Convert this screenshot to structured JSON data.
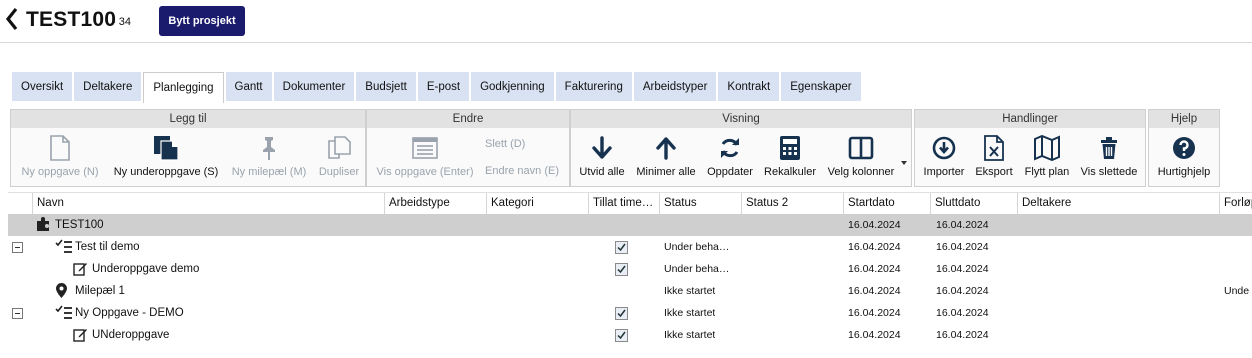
{
  "header": {
    "title": "TEST100",
    "subtitle": "- 34",
    "switch_project": "Bytt prosjekt"
  },
  "tabs": [
    {
      "label": "Oversikt"
    },
    {
      "label": "Deltakere"
    },
    {
      "label": "Planlegging",
      "active": true
    },
    {
      "label": "Gantt"
    },
    {
      "label": "Dokumenter"
    },
    {
      "label": "Budsjett"
    },
    {
      "label": "E-post"
    },
    {
      "label": "Godkjenning"
    },
    {
      "label": "Fakturering"
    },
    {
      "label": "Arbeidstyper"
    },
    {
      "label": "Kontrakt"
    },
    {
      "label": "Egenskaper"
    }
  ],
  "ribbon": {
    "legg_til": {
      "title": "Legg til",
      "ny_oppgave": "Ny oppgave (N)",
      "ny_underoppgave": "Ny underoppgave (S)",
      "ny_milepael": "Ny milepæl (M)",
      "dupliser": "Dupliser"
    },
    "endre": {
      "title": "Endre",
      "vis_oppgave": "Vis oppgave (Enter)",
      "slett": "Slett (D)",
      "endre_navn": "Endre navn (E)"
    },
    "visning": {
      "title": "Visning",
      "utvid_alle": "Utvid alle",
      "minimer_alle": "Minimer alle",
      "oppdater": "Oppdater",
      "rekalkuler": "Rekalkuler",
      "velg_kolonner": "Velg kolonner"
    },
    "handlinger": {
      "title": "Handlinger",
      "importer": "Importer",
      "eksport": "Eksport",
      "flytt_plan": "Flytt plan",
      "vis_slettede": "Vis slettede"
    },
    "hjelp": {
      "title": "Hjelp",
      "hurtighjelp": "Hurtighjelp"
    }
  },
  "grid": {
    "columns": {
      "navn": "Navn",
      "arbeidstype": "Arbeidstype",
      "kategori": "Kategori",
      "tillat_time": "Tillat time…",
      "status": "Status",
      "status2": "Status 2",
      "startdato": "Startdato",
      "sluttdato": "Sluttdato",
      "deltakere": "Deltakere",
      "forlop": "Forløp"
    },
    "rows": [
      {
        "name": "TEST100",
        "status": "",
        "start": "16.04.2024",
        "end": "16.04.2024",
        "forlop": ""
      },
      {
        "name": "Test til demo",
        "status": "Under beha…",
        "start": "16.04.2024",
        "end": "16.04.2024",
        "forlop": ""
      },
      {
        "name": "Underoppgave demo",
        "status": "Under beha…",
        "start": "16.04.2024",
        "end": "16.04.2024",
        "forlop": ""
      },
      {
        "name": "Milepæl 1",
        "status": "Ikke startet",
        "start": "16.04.2024",
        "end": "16.04.2024",
        "forlop": "Unde"
      },
      {
        "name": "Ny Oppgave - DEMO",
        "status": "Ikke startet",
        "start": "16.04.2024",
        "end": "16.04.2024",
        "forlop": ""
      },
      {
        "name": "UNderoppgave",
        "status": "Ikke startet",
        "start": "16.04.2024",
        "end": "16.04.2024",
        "forlop": ""
      }
    ]
  },
  "colors": {
    "primary": "#1b1b6e",
    "icon": "#16324f",
    "tab_bg": "#d8e2f2",
    "disabled": "#9aa3ad",
    "project_row": "#cfcfcf"
  }
}
